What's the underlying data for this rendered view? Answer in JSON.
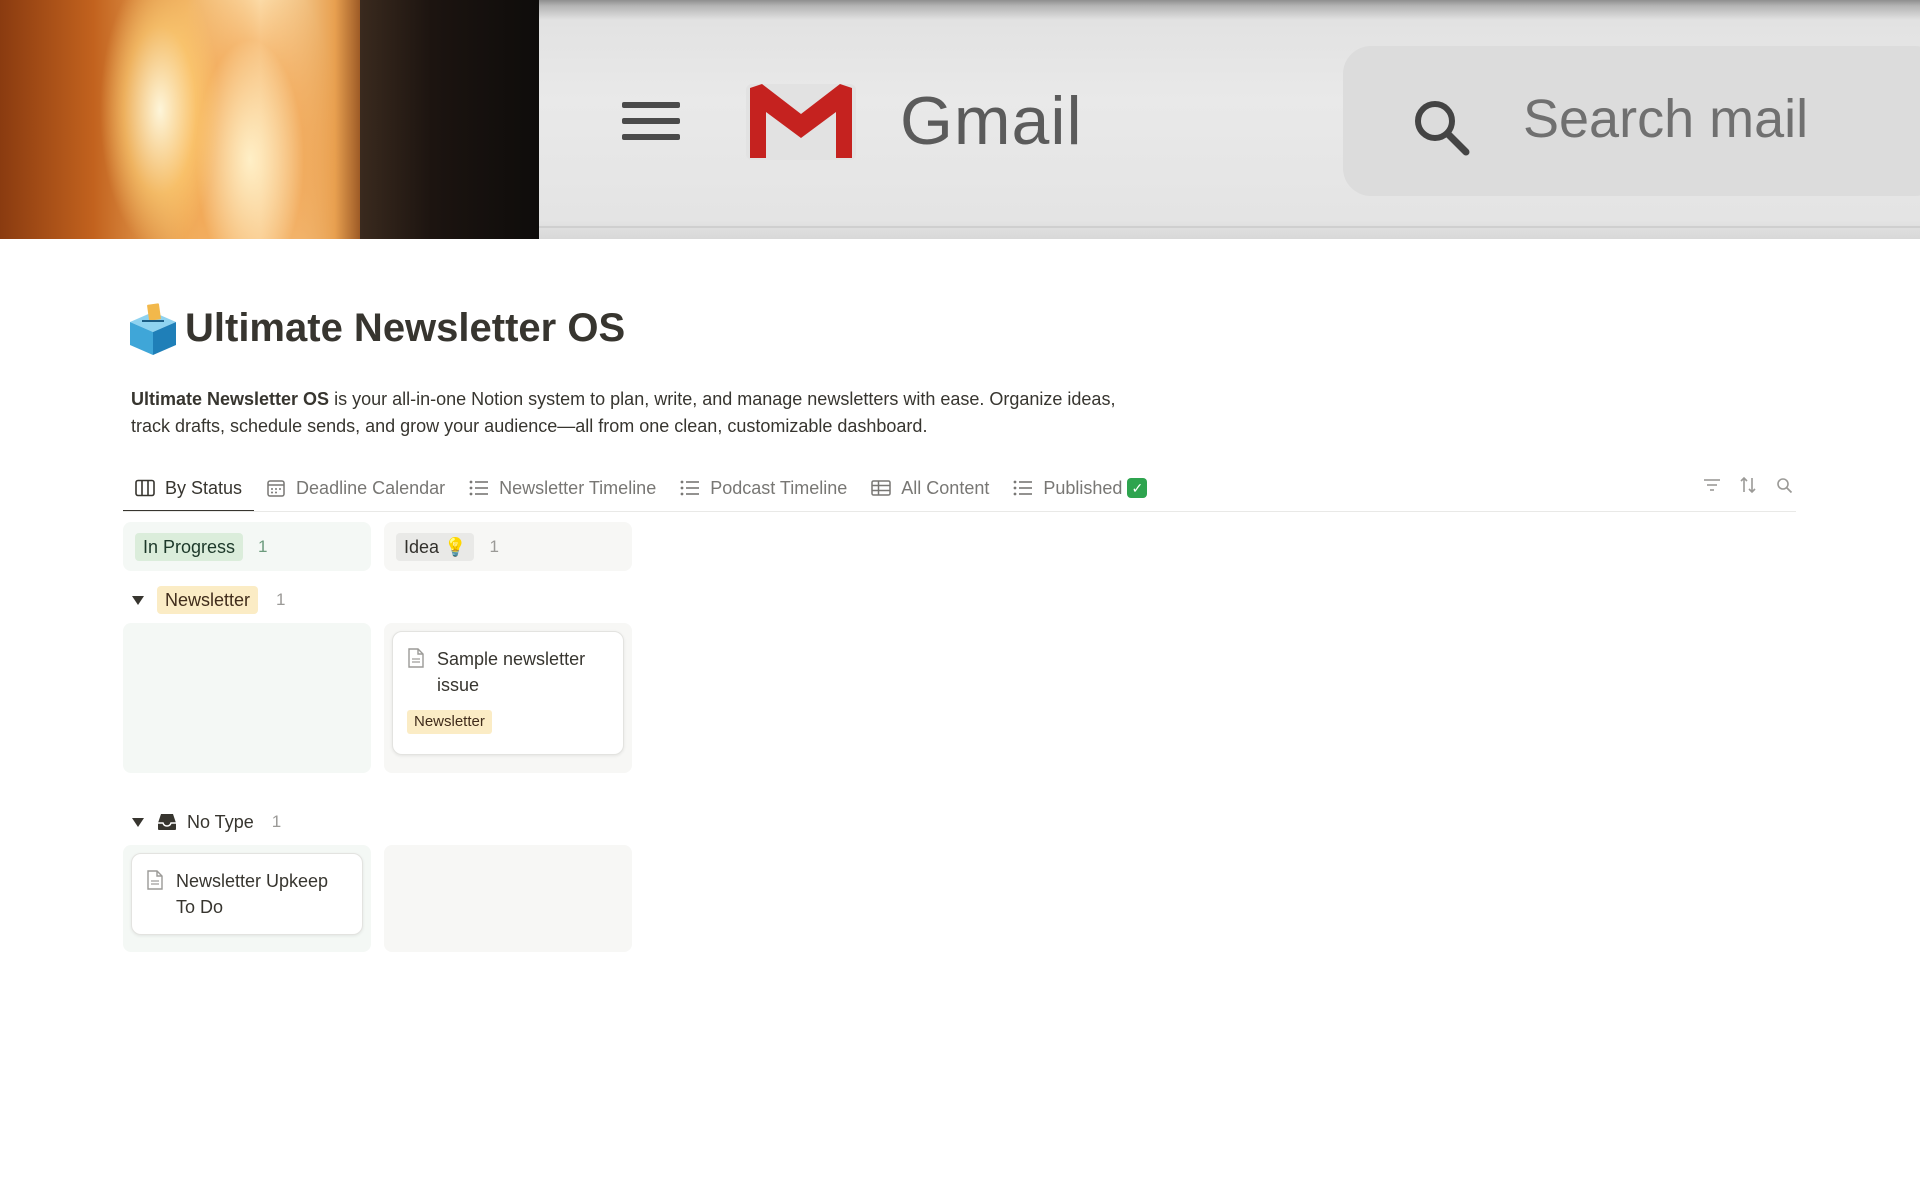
{
  "cover": {
    "gmail_text": "Gmail",
    "search_placeholder": "Search mail"
  },
  "page": {
    "title": "Ultimate Newsletter OS",
    "description_bold": "Ultimate Newsletter OS",
    "description_rest": " is your all-in-one Notion system to plan, write, and manage newsletters with ease. Organize ideas, track drafts, schedule sends, and grow your audience—all from one clean, customizable dashboard."
  },
  "tabs": [
    {
      "label": "By Status",
      "icon": "board-icon",
      "active": true
    },
    {
      "label": "Deadline Calendar",
      "icon": "calendar-icon",
      "active": false
    },
    {
      "label": "Newsletter Timeline",
      "icon": "list-icon",
      "active": false
    },
    {
      "label": "Podcast Timeline",
      "icon": "list-icon",
      "active": false
    },
    {
      "label": "All Content",
      "icon": "table-icon",
      "active": false
    },
    {
      "label": "Published",
      "icon": "list-icon",
      "badge": "✓",
      "active": false
    }
  ],
  "toolbar": {
    "filter_icon": "filter-icon",
    "sort_icon": "sort-icon",
    "search_icon": "search-icon"
  },
  "board": {
    "columns": [
      {
        "label": "In Progress",
        "count": "1",
        "color": "#dbeddb"
      },
      {
        "label": "Idea 💡",
        "count": "1",
        "color": "#e9e9e7"
      }
    ],
    "groups": [
      {
        "label": "Newsletter",
        "count": "1",
        "cards": [
          {
            "title": "Sample newsletter issue",
            "tag": "Newsletter",
            "column": "Idea 💡"
          }
        ]
      },
      {
        "label": "No Type",
        "count": "1",
        "icon": "inbox-icon",
        "cards": [
          {
            "title": "Newsletter Upkeep To Do",
            "column": "In Progress"
          }
        ]
      }
    ]
  },
  "colors": {
    "accent_text": "#37352f",
    "muted_text": "#787774",
    "green_bg": "#f4f8f5",
    "gray_bg": "#f7f7f5",
    "tag_yellow": "#fbecc5",
    "published_check": "#2ea44f"
  }
}
